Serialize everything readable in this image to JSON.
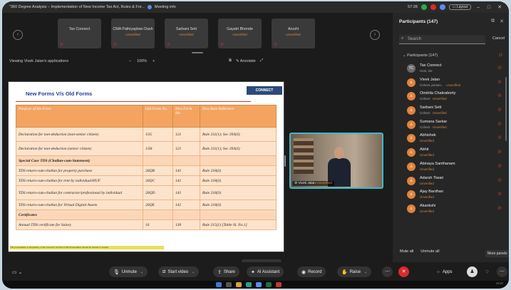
{
  "window": {
    "title": "\"360 Degree Analysis – Implementation of New Income Tax Act, Rules & For...",
    "meeting_label": "Meeting info",
    "time": "57:28",
    "layout_label": "Layout"
  },
  "thumbnails": [
    {
      "name": "Tax Connect",
      "status": ""
    },
    {
      "name": "CMA Pathiyapban Dash",
      "status": "Unverified"
    },
    {
      "name": "Sarbani Sett",
      "status": "Unverified"
    },
    {
      "name": "Gayatri Bhonde",
      "status": "Unverified"
    },
    {
      "name": "Arushi",
      "status": "Unverified"
    }
  ],
  "viewbar": {
    "label": "Viewing Vivek Jalan's applications",
    "zoom_minus": "–",
    "zoom_value": "100%",
    "zoom_plus": "+",
    "annotate": "Annotate"
  },
  "slide": {
    "title": "New Forms V/s Old Forms",
    "logo": "CONNECT",
    "headers": [
      "Purpose of the Form",
      "Old Form No.",
      "New Form No.",
      "New Rule Reference"
    ],
    "rows": [
      {
        "purpose": "Declaration for non-deduction (non-senior citizen)",
        "old": "15G",
        "new": "121",
        "rule": "Rule 211(1); Sec 393(6)"
      },
      {
        "purpose": "Declaration for non-deduction (senior citizen)",
        "old": "15H",
        "new": "121",
        "rule": "Rule 211(1); Sec 393(6)"
      },
      {
        "purpose": "Special Case TDS (Challan-cum-Statement)",
        "old": "",
        "new": "",
        "rule": ""
      },
      {
        "purpose": "TDS return-cum-challan for property purchase",
        "old": "26QB",
        "new": "141",
        "rule": "Rule 218(3)"
      },
      {
        "purpose": "TDS return-cum-challan for rent by individual/HUF",
        "old": "26QC",
        "new": "141",
        "rule": "Rule 218(3)"
      },
      {
        "purpose": "TDS return-cum-challan for contractor/professional by individual",
        "old": "26QD",
        "new": "141",
        "rule": "Rule 218(3)"
      },
      {
        "purpose": "TDS return-cum-challan for Virtual Digital Assets",
        "old": "26QE",
        "new": "141",
        "rule": "Rule 218(3)"
      },
      {
        "purpose": "Certificates",
        "old": "",
        "new": "",
        "rule": ""
      },
      {
        "purpose": "Annual TDS certificate for Salary",
        "old": "16",
        "new": "130",
        "rule": "Rule 215(1) [Table Sl. No.1]"
      }
    ],
    "footnote": "This presentation is proprietary of Tax Connect. No Part of this Presentation should be shared or Copied"
  },
  "pip": {
    "name": "Vivek Jalan",
    "status": "Unverified"
  },
  "panel": {
    "title": "Participants (147)",
    "search_placeholder": "Search",
    "cancel": "Cancel",
    "group_label": "Participants (147)",
    "mute_all": "Mute all",
    "unmute_all": "Unmute all",
    "participants": [
      {
        "initials": "TC",
        "name": "Tax Connect",
        "role": "Host, me",
        "status": ""
      },
      {
        "initials": "",
        "name": "Vivek Jalan",
        "role": "Cohost, presen...",
        "status": "Unverified"
      },
      {
        "initials": "",
        "name": "Oindrila Chakraborty",
        "role": "Cohost",
        "status": "Unverified"
      },
      {
        "initials": "",
        "name": "Sarbani Sett",
        "role": "Cohost",
        "status": "Unverified"
      },
      {
        "initials": "",
        "name": "Sumana Sarkar",
        "role": "Cohost",
        "status": "Unverified"
      },
      {
        "initials": "",
        "name": "Abhishek",
        "role": "",
        "status": "Unverified"
      },
      {
        "initials": "",
        "name": "Abhit",
        "role": "",
        "status": "Unverified"
      },
      {
        "initials": "",
        "name": "Abinaya Santhanam",
        "role": "",
        "status": "Unverified"
      },
      {
        "initials": "",
        "name": "Adarsh Tiwari",
        "role": "",
        "status": "Unverified"
      },
      {
        "initials": "",
        "name": "Ajay Bardhan",
        "role": "",
        "status": "Unverified"
      },
      {
        "initials": "",
        "name": "Akankshi",
        "role": "",
        "status": "Unverified"
      }
    ]
  },
  "controls": {
    "unmute": "Unmute",
    "start_video": "Start video",
    "share": "Share",
    "ai_assistant": "AI Assistant",
    "record": "Record",
    "raise": "Raise",
    "apps": "Apps",
    "more_panels": "More panels"
  },
  "taskbar": {
    "clock": "17:27"
  },
  "colors": {
    "accent": "#5b8def",
    "unverified": "#d48a3a",
    "end_call": "#d92b2b",
    "table_header": "#f4a460",
    "table_cell": "#fde3cb"
  }
}
